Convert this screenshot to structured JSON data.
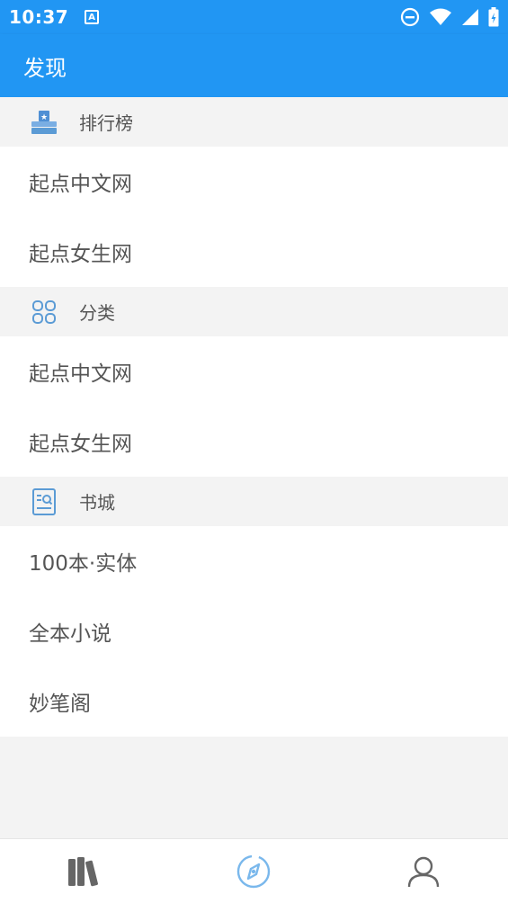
{
  "status_bar": {
    "time": "10:37",
    "indicator": "A",
    "icons": [
      "dnd-icon",
      "wifi-icon",
      "signal-icon",
      "battery-icon"
    ]
  },
  "app_bar": {
    "title": "发现"
  },
  "sections": [
    {
      "icon": "ranking-icon",
      "label": "排行榜",
      "items": [
        "起点中文网",
        "起点女生网"
      ]
    },
    {
      "icon": "category-grid-icon",
      "label": "分类",
      "items": [
        "起点中文网",
        "起点女生网"
      ]
    },
    {
      "icon": "bookstore-icon",
      "label": "书城",
      "items": [
        "100本·实体",
        "全本小说",
        "妙笔阁"
      ]
    }
  ],
  "bottom_nav": {
    "items": [
      "bookshelf-icon",
      "discover-icon",
      "profile-icon"
    ],
    "active": "discover-icon"
  },
  "colors": {
    "primary": "#2196f3",
    "icon_blue": "#5b9bd5",
    "text": "#555555",
    "background": "#f3f3f3"
  }
}
